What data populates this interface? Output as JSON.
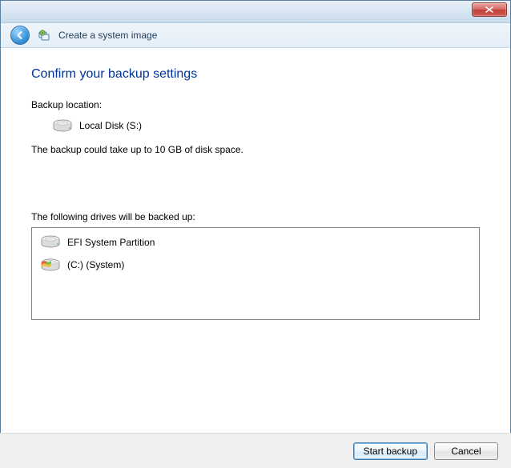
{
  "window": {
    "wizard_title": "Create a system image"
  },
  "page": {
    "heading": "Confirm your backup settings",
    "backup_location_label": "Backup location:",
    "backup_location_value": "Local Disk (S:)",
    "size_estimate": "The backup could take up to 10 GB of disk space.",
    "drives_label": "The following drives will be backed up:",
    "drives": [
      {
        "name": "EFI System Partition",
        "icon": "hdd"
      },
      {
        "name": "(C:) (System)",
        "icon": "windows-hdd"
      }
    ]
  },
  "buttons": {
    "start": "Start backup",
    "cancel": "Cancel"
  }
}
